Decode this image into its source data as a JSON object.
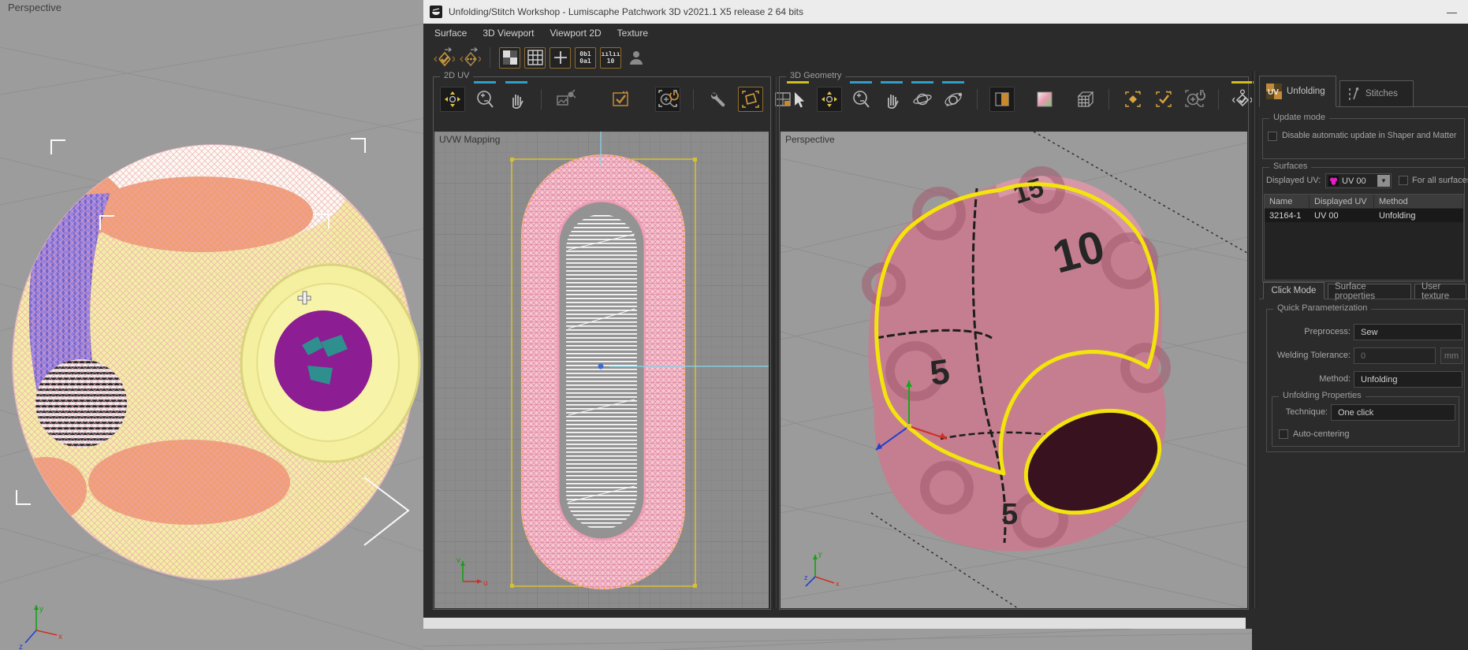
{
  "background": {
    "viewport_label": "Perspective",
    "axis": {
      "x": "x",
      "y": "y",
      "z": "z"
    }
  },
  "titlebar": {
    "title": "Unfolding/Stitch Workshop - Lumiscaphe Patchwork 3D v2021.1 X5 release 2 64 bits",
    "minimize": "—"
  },
  "menubar": {
    "items": {
      "surface": "Surface",
      "viewport3d": "3D Viewport",
      "viewport2d": "Viewport 2D",
      "texture": "Texture"
    }
  },
  "main_toolbar": {
    "levels_line1": "0b1",
    "levels_line2": "0a1",
    "ruler_bars": "ıılıı",
    "ruler_text": "10"
  },
  "panel2d": {
    "title": "2D UV",
    "viewport_label": "UVW Mapping",
    "axis_u": "u",
    "axis_v": "v"
  },
  "panel3d": {
    "title": "3D Geometry",
    "viewport_label": "Perspective",
    "axis_x": "x",
    "axis_y": "y",
    "axis_z": "z",
    "texture_numbers": [
      "15",
      "10",
      "5",
      "5"
    ]
  },
  "sidebar": {
    "tab_unfolding": "Unfolding",
    "tab_unfolding_icon_text": "UV",
    "tab_stitches": "Stitches",
    "update_mode": {
      "title": "Update mode",
      "checkbox_label": "Disable automatic update in Shaper and Matter"
    },
    "surfaces": {
      "title": "Surfaces",
      "displayed_uv_label": "Displayed UV:",
      "displayed_uv_value": "UV 00",
      "for_all_surfaces": "For all surfaces",
      "table": {
        "col_name": "Name",
        "col_displayed_uv": "Displayed UV",
        "col_method": "Method",
        "row": {
          "name": "32164-1",
          "displayed_uv": "UV 00",
          "method": "Unfolding"
        }
      }
    },
    "tabs2": {
      "click_mode": "Click Mode",
      "surface_properties": "Surface properties",
      "user_texture": "User texture"
    },
    "quick": {
      "title": "Quick Parameterization",
      "preprocess_label": "Preprocess:",
      "preprocess_value": "Sew",
      "welding_label": "Welding Tolerance:",
      "welding_value": "0",
      "welding_unit": "mm",
      "method_label": "Method:",
      "method_value": "Unfolding",
      "props": {
        "title": "Unfolding Properties",
        "technique_label": "Technique:",
        "technique_value": "One click",
        "auto_centering": "Auto-centering"
      }
    }
  },
  "colors": {
    "accent_orange": "#c08a3a",
    "accent_blue": "#2f9ec9",
    "accent_yellow": "#d2bd1e",
    "uv_magenta": "#e020c0",
    "seam_yellow": "#f2e40c",
    "viewport_gray": "#9c9c9c"
  }
}
